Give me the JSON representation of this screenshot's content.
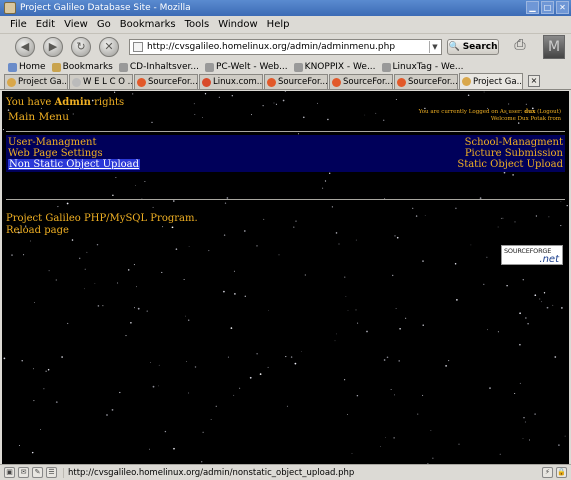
{
  "window": {
    "title": "Project Galileo Database Site - Mozilla"
  },
  "menubar": {
    "items": [
      "File",
      "Edit",
      "View",
      "Go",
      "Bookmarks",
      "Tools",
      "Window",
      "Help"
    ]
  },
  "navbar": {
    "url": "http://cvsgalileo.homelinux.org/admin/adminmenu.php",
    "search_label": "Search"
  },
  "bookmarks": {
    "items": [
      "Home",
      "Bookmarks",
      "CD-Inhaltsver...",
      "PC-Welt - Web...",
      "KNOPPIX - We...",
      "LinuxTag - We..."
    ]
  },
  "tabs": {
    "items": [
      "Project Ga...",
      "W E L C O ...",
      "SourceFor...",
      "Linux.com...",
      "SourceFor...",
      "SourceFor...",
      "SourceFor...",
      "Project Ga..."
    ],
    "active_index": 7,
    "close_symbol": "×"
  },
  "page": {
    "admin_prefix": "You have",
    "admin_role": "Admin",
    "admin_suffix": "rights",
    "main_menu": "Main Menu",
    "logged_in_line1": "You are currently Logged on As user: ",
    "logged_in_user": "dux",
    "logged_in_logout": "(Logout)",
    "logged_in_line2": "Welcome Dux Potak from",
    "menu_left": [
      "User-Managment",
      "Web Page Settings",
      "Non Static Object Upload"
    ],
    "menu_right": [
      "School-Managment",
      "Picture Submission",
      "Static Object Upload"
    ],
    "project_text": "Project Galileo PHP/MySQL Program.",
    "reload": "Reload page",
    "sf_logo_top": "SOURCEFORGE",
    "sf_logo_bottom": ".net"
  },
  "statusbar": {
    "url": "http://cvsgalileo.homelinux.org/admin/nonstatic_object_upload.php"
  },
  "colors": {
    "page_bg": "#000000",
    "link": "#f0b023",
    "menu_panel": "#00005a",
    "active_item": "#2b39d8"
  }
}
